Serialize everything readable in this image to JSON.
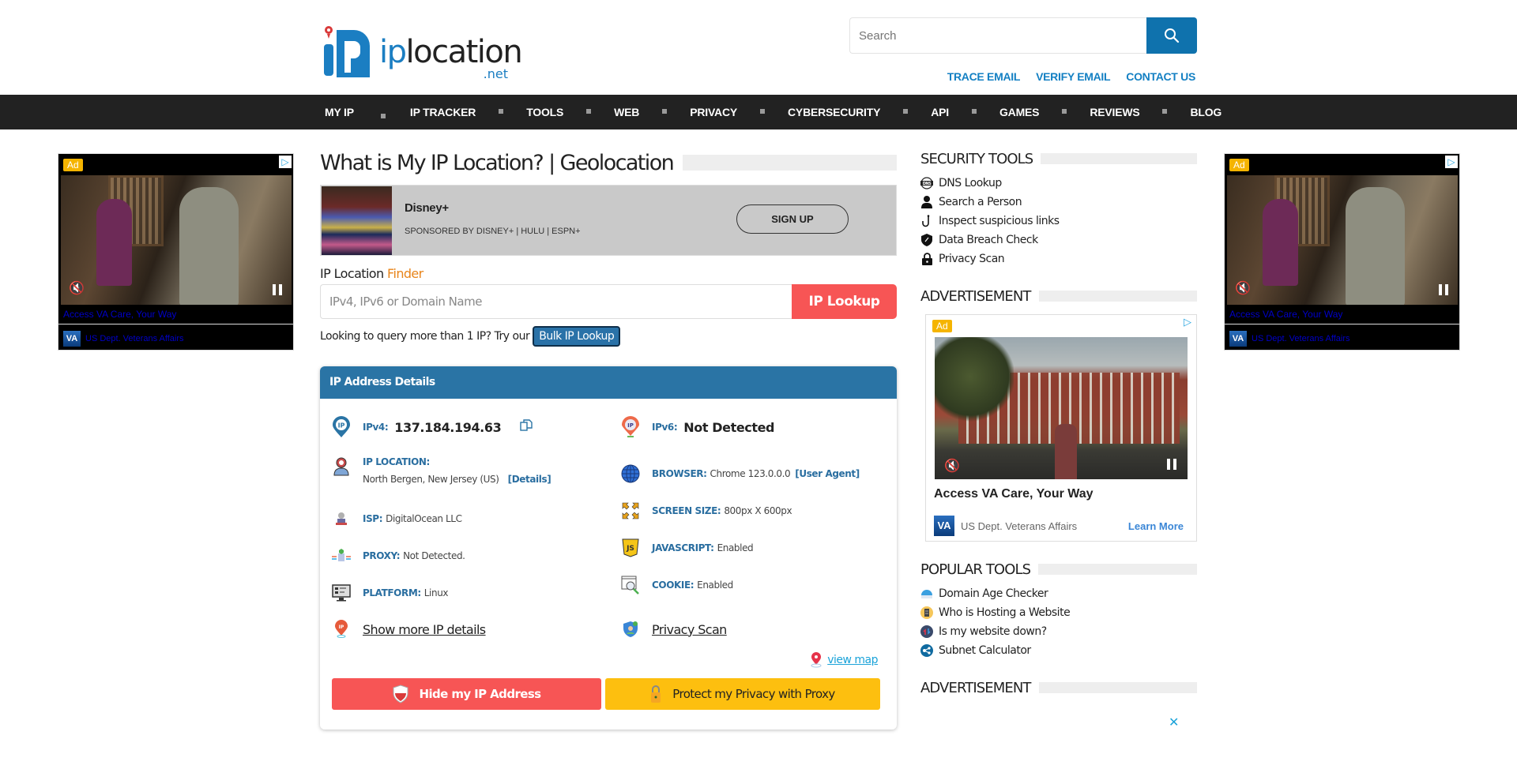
{
  "header": {
    "logo": {
      "text_main": "ip",
      "text_rest": "location",
      "text_tld": ".net"
    },
    "search": {
      "placeholder": "Search"
    },
    "top_links": [
      "TRACE EMAIL",
      "VERIFY EMAIL",
      "CONTACT US"
    ]
  },
  "nav": {
    "items": [
      "MY IP",
      "IP TRACKER",
      "TOOLS",
      "WEB",
      "PRIVACY",
      "CYBERSECURITY",
      "API",
      "GAMES",
      "REVIEWS",
      "BLOG"
    ]
  },
  "side_ads": {
    "badge": "Ad",
    "title": "Access VA Care, Your Way",
    "logo_text": "VA",
    "sponsor": "US Dept. Veterans Affairs"
  },
  "main": {
    "title": "What is My IP Location? | Geolocation",
    "sponsored_ad": {
      "name": "Disney+",
      "sponsor": "SPONSORED BY DISNEY+ | HULU | ESPN+",
      "button": "SIGN UP"
    },
    "finder": {
      "label": "IP Location",
      "label_accent": "Finder",
      "placeholder": "IPv4, IPv6 or Domain Name",
      "button": "IP Lookup",
      "bulk_text": "Looking to query more than 1 IP? Try our",
      "bulk_button": "Bulk IP Lookup"
    },
    "details": {
      "heading": "IP Address Details",
      "ipv4": {
        "label": "IPv4:",
        "value": "137.184.194.63"
      },
      "ipv6": {
        "label": "IPv6:",
        "value": "Not Detected"
      },
      "location": {
        "label": "IP LOCATION:",
        "value": "North Bergen, New Jersey (US)",
        "link": "[Details]"
      },
      "browser": {
        "label": "BROWSER:",
        "value": "Chrome 123.0.0.0",
        "link": "[User Agent]"
      },
      "isp": {
        "label": "ISP:",
        "value": "DigitalOcean LLC"
      },
      "screen": {
        "label": "SCREEN SIZE:",
        "value": "800px X 600px"
      },
      "proxy": {
        "label": "PROXY:",
        "value": "Not Detected."
      },
      "javascript": {
        "label": "JAVASCRIPT:",
        "value": "Enabled"
      },
      "platform": {
        "label": "PLATFORM:",
        "value": "Linux"
      },
      "cookie": {
        "label": "COOKIE:",
        "value": "Enabled"
      },
      "show_more": "Show more IP details",
      "privacy_scan": "Privacy Scan",
      "view_map": "view map",
      "hide_ip_button": "Hide my IP Address",
      "proxy_button": "Protect my Privacy with Proxy"
    }
  },
  "sidebar": {
    "security_tools": {
      "title": "SECURITY TOOLS",
      "items": [
        {
          "label": "DNS Lookup",
          "icon": "dns-icon"
        },
        {
          "label": "Search a Person",
          "icon": "person-icon"
        },
        {
          "label": "Inspect suspicious links",
          "icon": "hook-icon"
        },
        {
          "label": "Data Breach Check",
          "icon": "shield-icon"
        },
        {
          "label": "Privacy Scan",
          "icon": "lock-icon"
        }
      ]
    },
    "advertisement_title": "ADVERTISEMENT",
    "ad": {
      "badge": "Ad",
      "title": "Access VA Care, Your Way",
      "logo_text": "VA",
      "sponsor": "US Dept. Veterans Affairs",
      "cta": "Learn More"
    },
    "popular_tools": {
      "title": "POPULAR TOOLS",
      "items": [
        {
          "label": "Domain Age Checker",
          "icon": "domain-age-icon"
        },
        {
          "label": "Who is Hosting a Website",
          "icon": "server-icon"
        },
        {
          "label": "Is my website down?",
          "icon": "updown-icon"
        },
        {
          "label": "Subnet Calculator",
          "icon": "subnet-icon"
        }
      ]
    },
    "advertisement_title_2": "ADVERTISEMENT"
  },
  "colors": {
    "brand_blue": "#1b7ec2",
    "nav_bg": "#222222",
    "lookup_red": "#f75555",
    "proxy_yellow": "#fdbf0f",
    "details_header": "#2a74a5",
    "finder_accent": "#e8841a"
  }
}
